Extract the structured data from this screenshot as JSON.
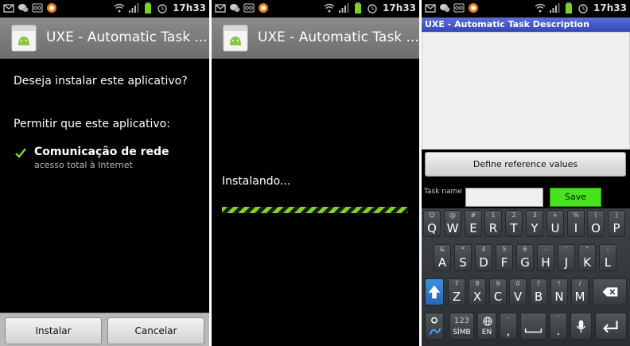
{
  "status_bar": {
    "time": "17h33"
  },
  "screen1": {
    "title": "UXE - Automatic Task ...",
    "question": "Deseja instalar este aplicativo?",
    "permissions_header": "Permitir que este aplicativo:",
    "permission": {
      "name": "Comunicação de rede",
      "description": "acesso total à Internet"
    },
    "buttons": {
      "install": "Instalar",
      "cancel": "Cancelar"
    }
  },
  "screen2": {
    "title": "UXE - Automatic Task ...",
    "status": "Instalando..."
  },
  "screen3": {
    "title": "UXE - Automatic Task Description",
    "define_button": "Define reference values",
    "task_name_label": "Task name",
    "task_name_value": "",
    "save_button": "Save",
    "keyboard": {
      "row1": [
        {
          "p": "Q",
          "s": "☺"
        },
        {
          "p": "W",
          "s": "@"
        },
        {
          "p": "E",
          "s": "#"
        },
        {
          "p": "R",
          "s": "1"
        },
        {
          "p": "T",
          "s": "2"
        },
        {
          "p": "Y",
          "s": "3"
        },
        {
          "p": "U",
          "s": "+"
        },
        {
          "p": "I",
          "s": "%"
        },
        {
          "p": "O",
          "s": "("
        },
        {
          "p": "P",
          "s": ")"
        }
      ],
      "row2": [
        {
          "p": "A",
          "s": "&"
        },
        {
          "p": "S",
          "s": "*"
        },
        {
          "p": "D",
          "s": "4"
        },
        {
          "p": "F",
          "s": "5"
        },
        {
          "p": "G",
          "s": "6"
        },
        {
          "p": "H",
          "s": "-"
        },
        {
          "p": "J",
          "s": "'"
        },
        {
          "p": "K",
          "s": "\""
        },
        {
          "p": "L",
          "s": ":"
        }
      ],
      "row3": [
        {
          "p": "Z",
          "s": "7"
        },
        {
          "p": "X",
          "s": "8"
        },
        {
          "p": "C",
          "s": "9"
        },
        {
          "p": "V",
          "s": "0"
        },
        {
          "p": "B",
          "s": "?"
        },
        {
          "p": "N",
          "s": "!"
        },
        {
          "p": "M",
          "s": "/"
        }
      ],
      "symbols_label": "SÍMB",
      "symbols_number": "123",
      "language_label": "EN",
      "comma": ",",
      "comma_sec": "-",
      "period": ".",
      "period_sec": "'"
    }
  }
}
